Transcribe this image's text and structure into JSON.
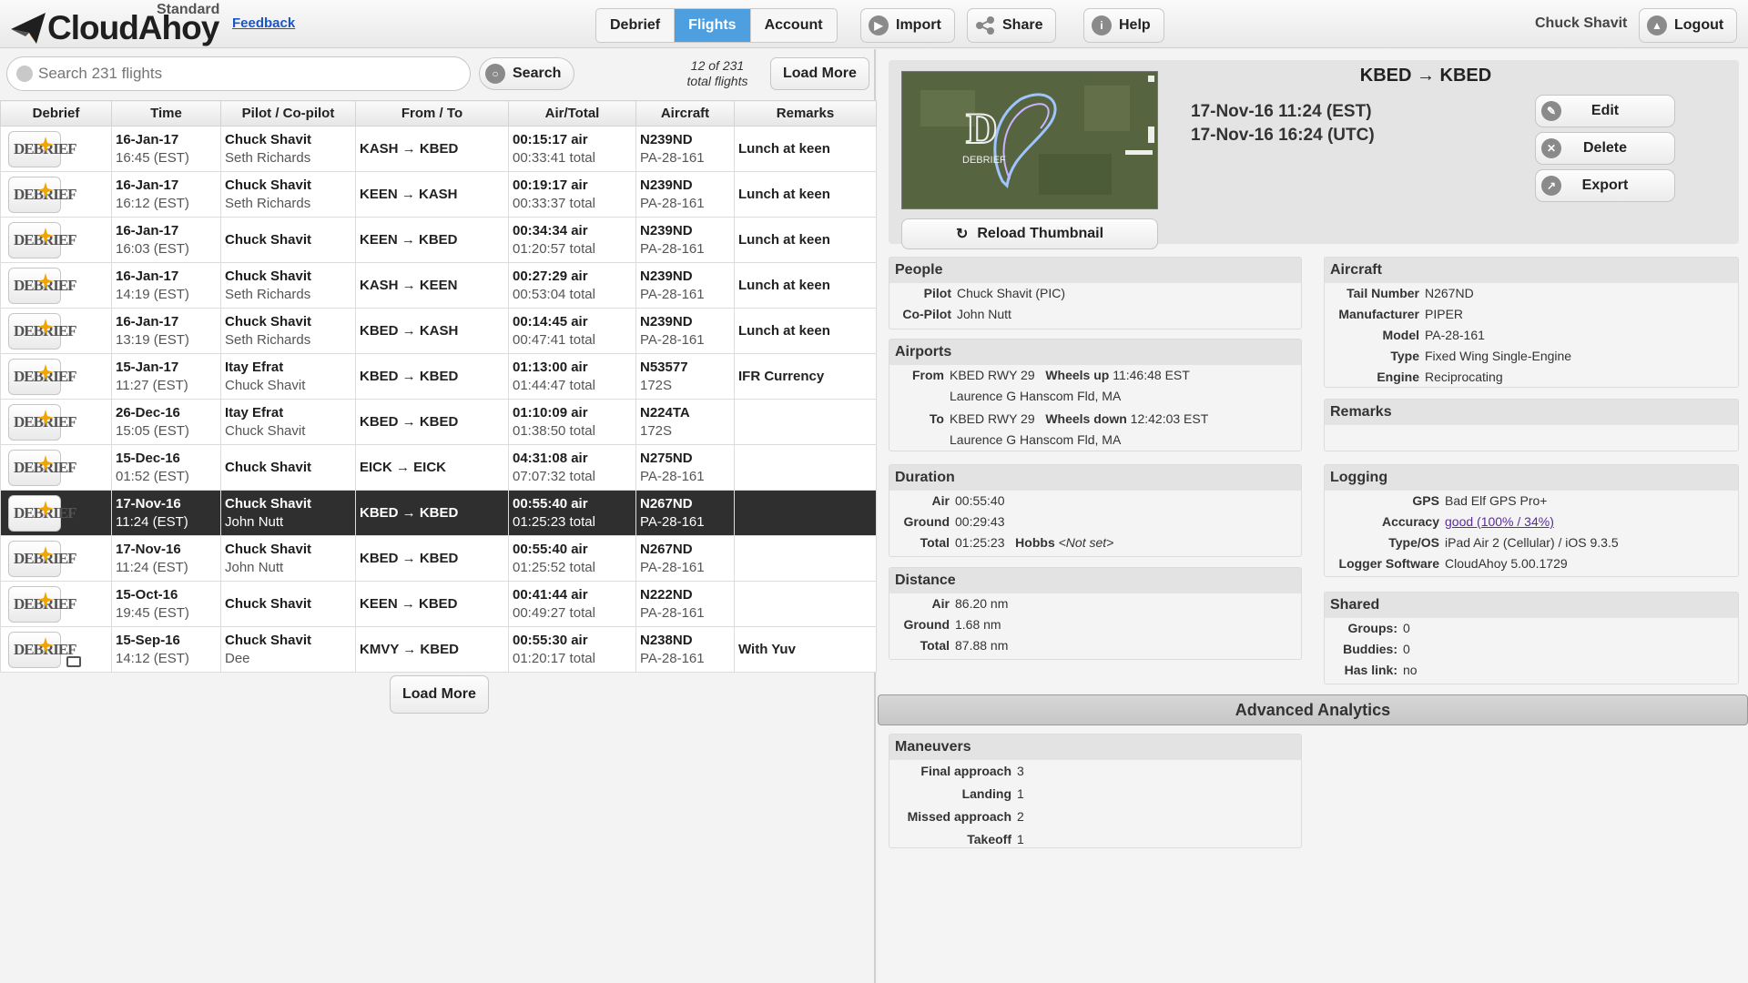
{
  "brand": {
    "name": "CloudAhoy",
    "edition": "Standard"
  },
  "header": {
    "feedback": "Feedback",
    "tabs": [
      "Debrief",
      "Flights",
      "Account"
    ],
    "active_tab": "Flights",
    "import_label": "Import",
    "share_label": "Share",
    "help_label": "Help",
    "user_name": "Chuck Shavit",
    "logout_label": "Logout"
  },
  "search": {
    "placeholder": "Search 231 flights",
    "button": "Search",
    "count_line1": "12 of 231",
    "count_line2": "total flights",
    "load_more": "Load More"
  },
  "table": {
    "columns": [
      "Debrief",
      "Time",
      "Pilot / Co-pilot",
      "From / To",
      "Air/Total",
      "Aircraft",
      "Remarks"
    ],
    "debrief_icon_text": "DEBRIEF",
    "rows": [
      {
        "date": "16-Jan-17",
        "time": "16:45 (EST)",
        "pilot": "Chuck Shavit",
        "copilot": "Seth Richards",
        "route": "KASH → KBED",
        "air": "00:15:17 air",
        "total": "00:33:41 total",
        "tail": "N239ND",
        "model": "PA-28-161",
        "remarks": "Lunch at keen"
      },
      {
        "date": "16-Jan-17",
        "time": "16:12 (EST)",
        "pilot": "Chuck Shavit",
        "copilot": "Seth Richards",
        "route": "KEEN → KASH",
        "air": "00:19:17 air",
        "total": "00:33:37 total",
        "tail": "N239ND",
        "model": "PA-28-161",
        "remarks": "Lunch at keen"
      },
      {
        "date": "16-Jan-17",
        "time": "16:03 (EST)",
        "pilot": "Chuck Shavit",
        "copilot": "",
        "route": "KEEN → KBED",
        "air": "00:34:34 air",
        "total": "01:20:57 total",
        "tail": "N239ND",
        "model": "PA-28-161",
        "remarks": "Lunch at keen"
      },
      {
        "date": "16-Jan-17",
        "time": "14:19 (EST)",
        "pilot": "Chuck Shavit",
        "copilot": "Seth Richards",
        "route": "KASH → KEEN",
        "air": "00:27:29 air",
        "total": "00:53:04 total",
        "tail": "N239ND",
        "model": "PA-28-161",
        "remarks": "Lunch at keen"
      },
      {
        "date": "16-Jan-17",
        "time": "13:19 (EST)",
        "pilot": "Chuck Shavit",
        "copilot": "Seth Richards",
        "route": "KBED → KASH",
        "air": "00:14:45 air",
        "total": "00:47:41 total",
        "tail": "N239ND",
        "model": "PA-28-161",
        "remarks": "Lunch at keen"
      },
      {
        "date": "15-Jan-17",
        "time": "11:27 (EST)",
        "pilot": "Itay Efrat",
        "copilot": "Chuck Shavit",
        "route": "KBED → KBED",
        "air": "01:13:00 air",
        "total": "01:44:47 total",
        "tail": "N53577",
        "model": "172S",
        "remarks": "IFR Currency"
      },
      {
        "date": "26-Dec-16",
        "time": "15:05 (EST)",
        "pilot": "Itay Efrat",
        "copilot": "Chuck Shavit",
        "route": "KBED → KBED",
        "air": "01:10:09 air",
        "total": "01:38:50 total",
        "tail": "N224TA",
        "model": "172S",
        "remarks": ""
      },
      {
        "date": "15-Dec-16",
        "time": "01:52 (EST)",
        "pilot": "Chuck Shavit",
        "copilot": "",
        "route": "EICK → EICK",
        "air": "04:31:08 air",
        "total": "07:07:32 total",
        "tail": "N275ND",
        "model": "PA-28-161",
        "remarks": ""
      },
      {
        "date": "17-Nov-16",
        "time": "11:24 (EST)",
        "pilot": "Chuck Shavit",
        "copilot": "John Nutt",
        "route": "KBED → KBED",
        "air": "00:55:40 air",
        "total": "01:25:23 total",
        "tail": "N267ND",
        "model": "PA-28-161",
        "remarks": ""
      },
      {
        "date": "17-Nov-16",
        "time": "11:24 (EST)",
        "pilot": "Chuck Shavit",
        "copilot": "John Nutt",
        "route": "KBED → KBED",
        "air": "00:55:40 air",
        "total": "01:25:52 total",
        "tail": "N267ND",
        "model": "PA-28-161",
        "remarks": ""
      },
      {
        "date": "15-Oct-16",
        "time": "19:45 (EST)",
        "pilot": "Chuck Shavit",
        "copilot": "",
        "route": "KEEN → KBED",
        "air": "00:41:44 air",
        "total": "00:49:27 total",
        "tail": "N222ND",
        "model": "PA-28-161",
        "remarks": ""
      },
      {
        "date": "15-Sep-16",
        "time": "14:12 (EST)",
        "pilot": "Chuck Shavit",
        "copilot": "Dee",
        "route": "KMVY → KBED",
        "air": "00:55:30 air",
        "total": "01:20:17 total",
        "tail": "N238ND",
        "model": "PA-28-161",
        "remarks": "With Yuv"
      }
    ],
    "load_more_bottom": "Load More"
  },
  "detail": {
    "title": "KBED → KBED",
    "datetime_local": "17-Nov-16 11:24 (EST)",
    "datetime_utc": "17-Nov-16 16:24 (UTC)",
    "edit": "Edit",
    "delete": "Delete",
    "export": "Export",
    "reload_thumbnail": "Reload Thumbnail",
    "thumb_text": "DEBRIEF",
    "people": {
      "title": "People",
      "pilot_k": "Pilot",
      "pilot_v": "Chuck Shavit (PIC)",
      "copilot_k": "Co-Pilot",
      "copilot_v": "John Nutt"
    },
    "airports": {
      "title": "Airports",
      "from_k": "From",
      "from_v": "KBED  RWY 29",
      "wheels_up_k": "Wheels up",
      "wheels_up_v": "11:46:48 EST",
      "from_name": "Laurence G Hanscom Fld, MA",
      "to_k": "To",
      "to_v": "KBED  RWY 29",
      "wheels_down_k": "Wheels down",
      "wheels_down_v": "12:42:03 EST",
      "to_name": "Laurence G Hanscom Fld, MA"
    },
    "duration": {
      "title": "Duration",
      "air_k": "Air",
      "air_v": "00:55:40",
      "ground_k": "Ground",
      "ground_v": "00:29:43",
      "total_k": "Total",
      "total_v": "01:25:23",
      "hobbs_k": "Hobbs",
      "hobbs_v": "<Not set>"
    },
    "distance": {
      "title": "Distance",
      "air_k": "Air",
      "air_v": "86.20 nm",
      "ground_k": "Ground",
      "ground_v": "1.68 nm",
      "total_k": "Total",
      "total_v": "87.88 nm"
    },
    "aircraft": {
      "title": "Aircraft",
      "tail_k": "Tail Number",
      "tail_v": "N267ND",
      "mfr_k": "Manufacturer",
      "mfr_v": "PIPER",
      "model_k": "Model",
      "model_v": "PA-28-161",
      "type_k": "Type",
      "type_v": "Fixed Wing Single-Engine",
      "engine_k": "Engine",
      "engine_v": "Reciprocating"
    },
    "remarks": {
      "title": "Remarks"
    },
    "logging": {
      "title": "Logging",
      "gps_k": "GPS",
      "gps_v": "Bad Elf GPS Pro+",
      "acc_k": "Accuracy",
      "acc_v": "good (100% / 34%)",
      "os_k": "Type/OS",
      "os_v": "iPad Air 2 (Cellular) / iOS 9.3.5",
      "sw_k": "Logger Software",
      "sw_v": "CloudAhoy 5.00.1729"
    },
    "shared": {
      "title": "Shared",
      "groups_k": "Groups:",
      "groups_v": "0",
      "buddies_k": "Buddies:",
      "buddies_v": "0",
      "link_k": "Has link:",
      "link_v": "no"
    },
    "advanced": "Advanced Analytics",
    "maneuvers": {
      "title": "Maneuvers",
      "final_k": "Final approach",
      "final_v": "3",
      "landing_k": "Landing",
      "landing_v": "1",
      "missed_k": "Missed approach",
      "missed_v": "2",
      "takeoff_k": "Takeoff",
      "takeoff_v": "1"
    }
  }
}
